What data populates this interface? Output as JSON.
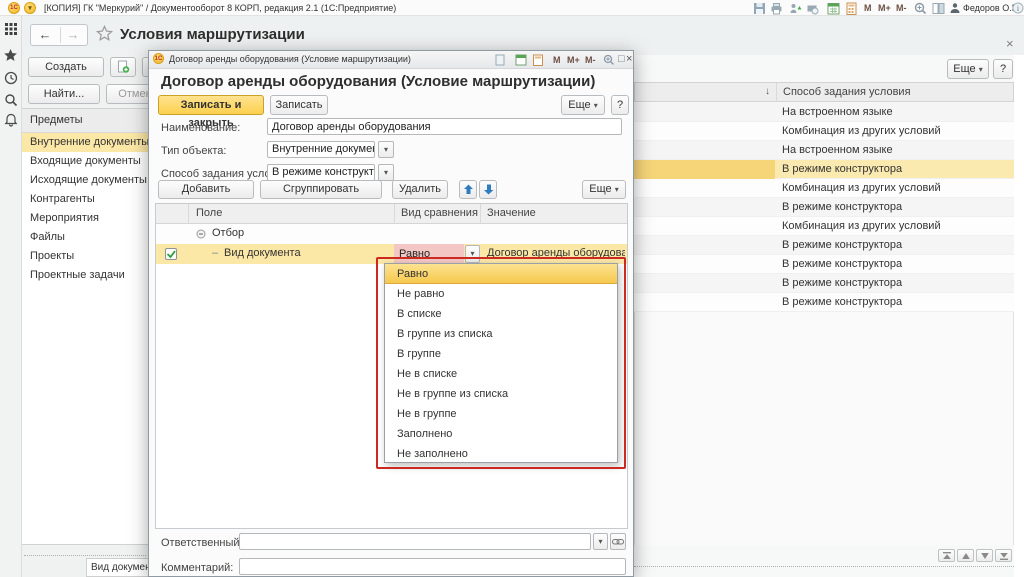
{
  "titlebar": {
    "title": "[КОПИЯ] ГК \"Меркурий\" / Документооборот 8 КОРП, редакция 2.1   (1С:Предприятие)",
    "logo": "1С",
    "memory_buttons": [
      "M",
      "M+",
      "M-"
    ],
    "user": "Федоров О.П."
  },
  "header": {
    "title": "Условия маршрутизации",
    "back": "←",
    "forward": "→",
    "close": "×"
  },
  "left_panel": {
    "create_button": "Создать",
    "find_top_button": "Найти",
    "find_button": "Найти...",
    "cancel_search_button": "Отменить по",
    "group_header": "Предметы",
    "items": [
      "Внутренние документы",
      "Входящие документы",
      "Исходящие документы",
      "Контрагенты",
      "Мероприятия",
      "Файлы",
      "Проекты",
      "Проектные задачи"
    ]
  },
  "main_list": {
    "more_button": "Еще",
    "help_button": "?",
    "sort_arrow": "↓",
    "column_header": "Способ задания условия",
    "rows": [
      "На встроенном языке",
      "Комбинация из других условий",
      "На встроенном языке",
      "В режиме конструктора",
      "Комбинация из других условий",
      "В режиме конструктора",
      "Комбинация из других условий",
      "В режиме конструктора",
      "В режиме конструктора",
      "В режиме конструктора",
      "В режиме конструктора"
    ],
    "preview_partial_text": "Вид документа Равно \"Дого"
  },
  "dialog": {
    "window_title": "Договор аренды оборудования (Условие маршрутизации)",
    "heading": "Договор аренды оборудования (Условие маршрутизации)",
    "memory_buttons": [
      "M",
      "M+",
      "M-"
    ],
    "maximize": "□",
    "close": "×",
    "save_and_close_button": "Записать и закрыть",
    "save_button": "Записать",
    "more_button": "Еще",
    "help_button": "?",
    "name_label": "Наименование:",
    "name_value": "Договор аренды оборудования",
    "type_label": "Тип объекта:",
    "type_value": "Внутренние документы",
    "method_label": "Способ задания условия:",
    "method_value": "В режиме конструктора",
    "rules_toolbar": {
      "add_button": "Добавить правило",
      "group_button": "Сгруппировать правила",
      "delete_button": "Удалить",
      "more_button": "Еще"
    },
    "table": {
      "col_field": "Поле",
      "col_comparison": "Вид сравнения",
      "col_value": "Значение",
      "group_row": "Отбор",
      "row_field": "Вид документа",
      "row_comparison": "Равно",
      "row_value": "Договор аренды оборудования"
    },
    "dropdown_items": [
      "Равно",
      "Не равно",
      "В списке",
      "В группе из списка",
      "В группе",
      "Не в списке",
      "Не в группе из списка",
      "Не в группе",
      "Заполнено",
      "Не заполнено"
    ],
    "responsible_label": "Ответственный:",
    "comment_label": "Комментарий:"
  }
}
